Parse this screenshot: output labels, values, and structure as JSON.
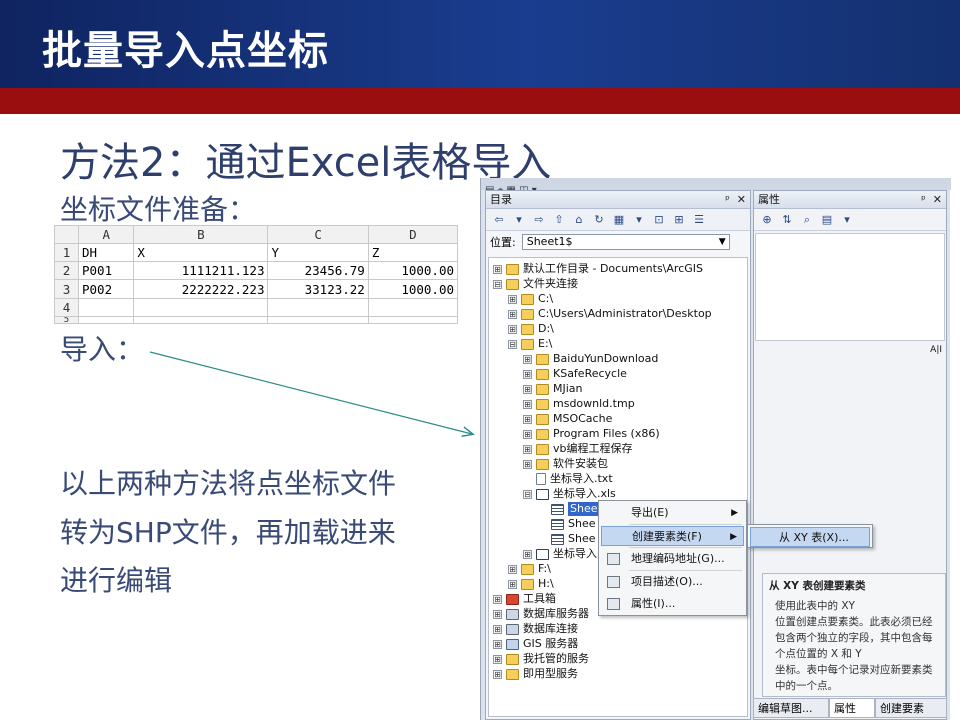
{
  "slide": {
    "title": "批量导入点坐标",
    "heading": "方法2：通过Excel表格导入",
    "sub_prepare": "坐标文件准备：",
    "sub_import": "导入：",
    "body_lines": [
      "以上两种方法将点坐标文件",
      "转为SHP文件，再加载进来",
      "进行编辑"
    ]
  },
  "excel": {
    "columns": [
      "A",
      "B",
      "C",
      "D"
    ],
    "rows": [
      {
        "num": "1",
        "cells": [
          "DH",
          "X",
          "Y",
          "Z"
        ]
      },
      {
        "num": "2",
        "cells": [
          "P001",
          "1111211.123",
          "23456.79",
          "1000.00"
        ]
      },
      {
        "num": "3",
        "cells": [
          "P002",
          "2222222.223",
          "33123.22",
          "1000.00"
        ]
      },
      {
        "num": "4",
        "cells": [
          "",
          "",
          "",
          ""
        ]
      },
      {
        "num": "5",
        "cells": [
          "",
          "",
          "",
          ""
        ]
      }
    ]
  },
  "catalog": {
    "pane_title": "目录",
    "pin": "ᵖ",
    "close": "✕",
    "location_label": "位置:",
    "location_value": "Sheet1$",
    "tree": [
      {
        "label": "默认工作目录 - Documents\\ArcGIS",
        "exp": "⊞",
        "icon": "folder"
      },
      {
        "label": "文件夹连接",
        "exp": "⊟",
        "icon": "folder"
      },
      {
        "label": "C:\\",
        "exp": "⊞",
        "icon": "folder"
      },
      {
        "label": "C:\\Users\\Administrator\\Desktop",
        "exp": "⊞",
        "icon": "folder"
      },
      {
        "label": "D:\\",
        "exp": "⊞",
        "icon": "folder"
      },
      {
        "label": "E:\\",
        "exp": "⊟",
        "icon": "folder"
      },
      {
        "label": "BaiduYunDownload",
        "exp": "⊞",
        "icon": "folder"
      },
      {
        "label": "KSafeRecycle",
        "exp": "⊞",
        "icon": "folder"
      },
      {
        "label": "MJian",
        "exp": "⊞",
        "icon": "folder"
      },
      {
        "label": "msdownld.tmp",
        "exp": "⊞",
        "icon": "folder"
      },
      {
        "label": "MSOCache",
        "exp": "⊞",
        "icon": "folder"
      },
      {
        "label": "Program Files (x86)",
        "exp": "⊞",
        "icon": "folder"
      },
      {
        "label": "vb编程工程保存",
        "exp": "⊞",
        "icon": "folder"
      },
      {
        "label": "软件安装包",
        "exp": "⊞",
        "icon": "folder"
      },
      {
        "label": "坐标导入.txt",
        "exp": "",
        "icon": "file"
      },
      {
        "label": "坐标导入.xls",
        "exp": "⊟",
        "icon": "xls"
      },
      {
        "label": "Sheet1$",
        "exp": "",
        "icon": "sheet"
      },
      {
        "label": "Shee",
        "exp": "",
        "icon": "sheet"
      },
      {
        "label": "Shee",
        "exp": "",
        "icon": "sheet"
      },
      {
        "label": "坐标导入",
        "exp": "⊞",
        "icon": "xls"
      },
      {
        "label": "F:\\",
        "exp": "⊞",
        "icon": "folder"
      },
      {
        "label": "H:\\",
        "exp": "⊞",
        "icon": "folder"
      },
      {
        "label": "工具箱",
        "exp": "⊞",
        "icon": "tool"
      },
      {
        "label": "数据库服务器",
        "exp": "⊞",
        "icon": "db"
      },
      {
        "label": "数据库连接",
        "exp": "⊞",
        "icon": "db"
      },
      {
        "label": "GIS 服务器",
        "exp": "⊞",
        "icon": "gis"
      },
      {
        "label": "我托管的服务",
        "exp": "⊞",
        "icon": "folder"
      },
      {
        "label": "即用型服务",
        "exp": "⊞",
        "icon": "folder"
      }
    ]
  },
  "properties": {
    "pane_title": "属性",
    "mini_labels": "A|I",
    "tooltip_title": "从 XY 表创建要素类",
    "tooltip_lines": [
      "使用此表中的 XY",
      "位置创建点要素类。此表必须已经",
      "包含两个独立的字段，其中包含每",
      "个点位置的 X 和 Y",
      "坐标。表中每个记录对应新要素类",
      "中的一个点。"
    ]
  },
  "bottom_tabs": [
    "编辑草图...",
    "属性",
    "创建要素"
  ],
  "context_menu": {
    "items": [
      "导出(E)",
      "创建要素类(F)",
      "地理编码地址(G)...",
      "项目描述(O)...",
      "属性(I)..."
    ],
    "submenu_item": "从 XY 表(X)..."
  },
  "colors": {
    "title_bar": "#1a3d8f",
    "red_bar": "#9b0e10",
    "heading_text": "#2e3f6e",
    "arrow": "#2f8a8a",
    "selection": "#3366cc"
  }
}
